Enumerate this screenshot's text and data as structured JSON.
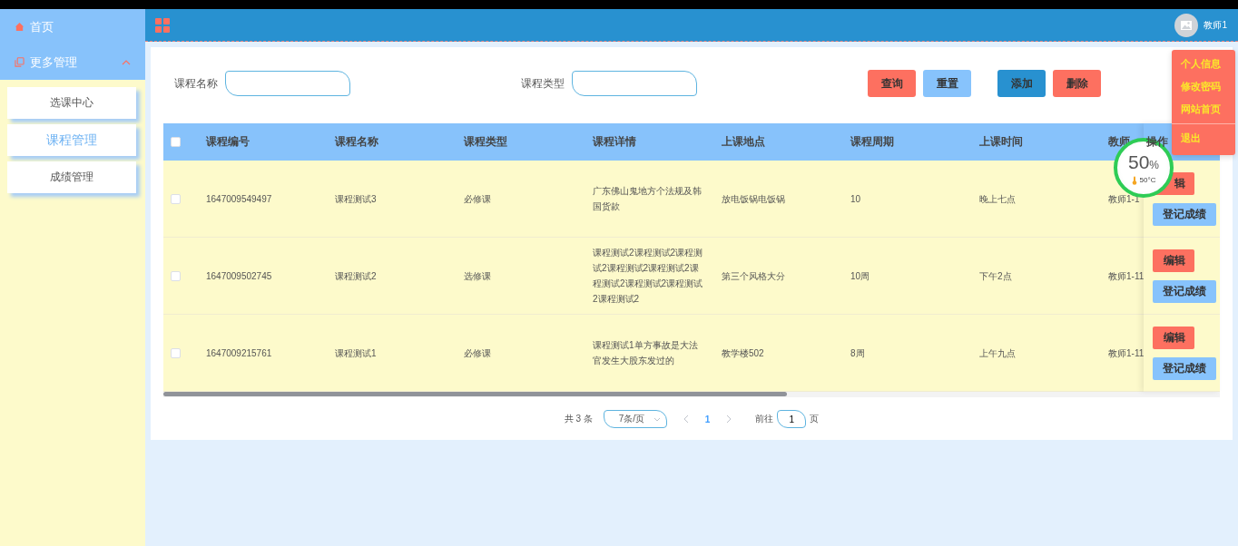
{
  "sidebar": {
    "items": [
      {
        "kind": "link",
        "label": "首页"
      },
      {
        "kind": "group",
        "label": "更多管理",
        "expanded": true,
        "children": [
          {
            "label": "选课中心",
            "selected": false
          },
          {
            "label": "课程管理",
            "selected": true
          },
          {
            "label": "成绩管理",
            "selected": false
          }
        ]
      }
    ]
  },
  "header": {
    "user": "教师1"
  },
  "user_menu": {
    "items": [
      {
        "label": "个人信息",
        "divided": false
      },
      {
        "label": "修改密码",
        "divided": false
      },
      {
        "label": "网站首页",
        "divided": false
      },
      {
        "label": "退出",
        "divided": true
      }
    ]
  },
  "search": {
    "fields": [
      {
        "label": "课程名称"
      },
      {
        "label": "课程类型"
      }
    ],
    "buttons": [
      {
        "label": "查询",
        "color": "#fd7060"
      },
      {
        "label": "重置",
        "color": "#87c3fc"
      },
      {
        "label": "添加",
        "color": "#2891d0"
      },
      {
        "label": "删除",
        "color": "#fd7060"
      }
    ]
  },
  "table": {
    "select_all": {
      "checked": false
    },
    "columns": [
      "课程编号",
      "课程名称",
      "课程类型",
      "课程详情",
      "上课地点",
      "课程周期",
      "上课时间",
      "教师"
    ],
    "actions_header": "操作",
    "rows": [
      {
        "selected": false,
        "cells": [
          "1647009549497",
          "课程测试3",
          "必修课",
          "广东佛山鬼地方个法规及韩国货款",
          "放电饭锅电饭锅",
          "10",
          "晚上七点",
          "教师1-1"
        ],
        "actions": [
          "辑",
          "登记成绩"
        ]
      },
      {
        "selected": false,
        "cells": [
          "1647009502745",
          "课程测试2",
          "选修课",
          "课程测试2课程测试2课程测试2课程测试2课程测试2课程测试2课程测试2课程测试2课程测试2",
          "第三个风格大分",
          "10周",
          "下午2点",
          "教师1-11"
        ],
        "actions": [
          "编辑",
          "登记成绩"
        ]
      },
      {
        "selected": false,
        "cells": [
          "1647009215761",
          "课程测试1",
          "必修课",
          "课程测试1单方事故是大法官发生大股东发过的",
          "教学楼502",
          "8周",
          "上午九点",
          "教师1-11"
        ],
        "actions": [
          "编辑",
          "登记成绩"
        ]
      }
    ]
  },
  "pagination": {
    "total": "共 3 条",
    "page_size": "7条/页",
    "pages": [
      {
        "label": "1",
        "selected": true
      }
    ],
    "goto_label": "前往",
    "goto_value": "1",
    "goto_suffix": "页"
  },
  "monitor": {
    "percent": "50",
    "percent_unit": "%",
    "temperature": "50°C"
  }
}
